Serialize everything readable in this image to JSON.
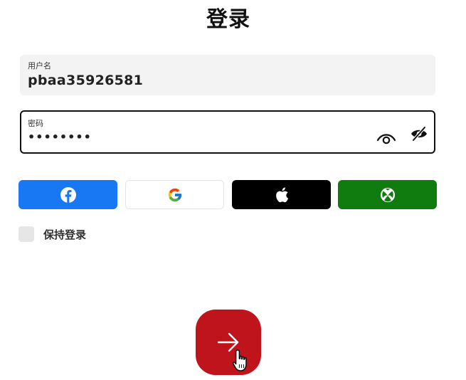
{
  "page": {
    "title": "登录"
  },
  "username": {
    "label": "用户名",
    "value": "pbaa35926581"
  },
  "password": {
    "label": "密码",
    "value": "••••••••",
    "show_icon": "eye-icon",
    "hide_icon": "eye-off-icon"
  },
  "social": [
    {
      "provider": "facebook",
      "icon": "facebook-icon",
      "color": "#1877f2"
    },
    {
      "provider": "google",
      "icon": "google-icon",
      "color": "#ffffff"
    },
    {
      "provider": "apple",
      "icon": "apple-icon",
      "color": "#000000"
    },
    {
      "provider": "xbox",
      "icon": "xbox-icon",
      "color": "#107c10"
    }
  ],
  "remember": {
    "label": "保持登录",
    "checked": false
  },
  "submit": {
    "icon": "arrow-right-icon",
    "color": "#c0141c"
  }
}
